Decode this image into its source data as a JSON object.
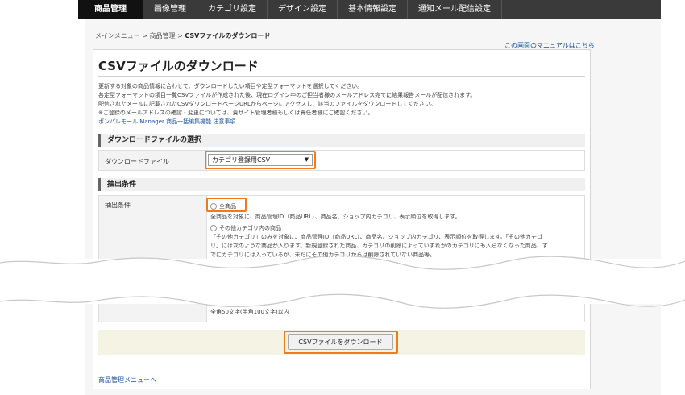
{
  "nav": {
    "tabs": [
      "商品管理",
      "画像管理",
      "カテゴリ設定",
      "デザイン設定",
      "基本情報設定",
      "通知メール配信設定"
    ]
  },
  "breadcrumb": {
    "main_menu": "メインメニュー",
    "sep": " > ",
    "product": "商品管理",
    "current": "CSVファイルのダウンロード"
  },
  "manual_link": "この画面のマニュアルはこちら",
  "page_title": "CSVファイルのダウンロード",
  "description": [
    "更新する対象の商品情報に合わせて、ダウンロードしたい項目や定型フォーマットを選択してください。",
    "各定型フォーマットの項目一覧CSVファイルが作成された後、現在ログイン中のご担当者様のメールアドレス宛てに結果報告メールが配信されます。",
    "配信されたメールに記載されたCSVダウンロードページURLからページにアクセスし、該当のファイルをダウンロードしてください。",
    "※ご登録のメールアドレスの確認・変更については、貴サイト管理者様もしくは責任者様にご確認ください。"
  ],
  "notice_link": "ポンパレモール Manager 商品一括編集機能 注意事項",
  "file_section": {
    "heading": "ダウンロードファイルの選択",
    "label": "ダウンロードファイル",
    "selected": "カテゴリ登録用CSV"
  },
  "condition_section": {
    "heading": "抽出条件",
    "label": "抽出条件",
    "all_label": "全商品",
    "all_desc": "全商品を対象に、商品管理ID（商品URL）、商品名、ショップ内カテゴリ、表示順位を取得します。",
    "other_label": "その他カテゴリ内の商品",
    "other_desc": [
      "「その他カテゴリ」のみを対象に、商品管理ID（商品URL）、商品名、ショップ内カテゴリ、表示順位を取得します。「その他カテゴ",
      "リ」には次のような商品が入ります。新規登録された商品、カテゴリの削除によっていずれかのカテゴリにも入らなくなった商品、す",
      "でにカテゴリには入っているが、未だにその他カテゴリからは削除されていない商品等。"
    ],
    "char_limit": "全角50文字(半角100文字)以内"
  },
  "download_button": "CSVファイルをダウンロード",
  "back_link": "商品管理メニューへ",
  "colors": {
    "highlight": "#f07a1c",
    "topbar": "#3a3a3a"
  }
}
